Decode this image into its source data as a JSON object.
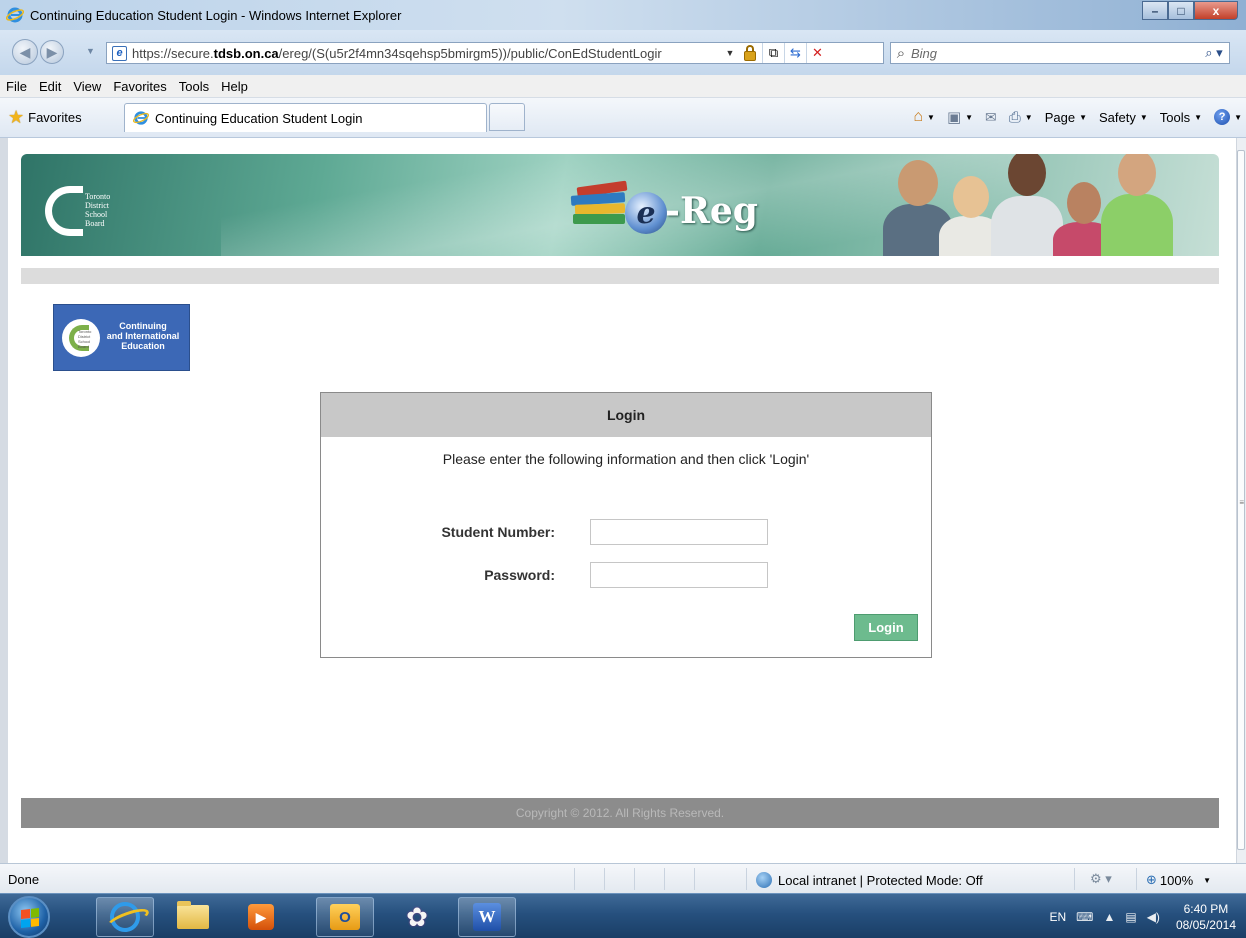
{
  "window": {
    "title": "Continuing Education Student Login - Windows Internet Explorer",
    "min_glyph": "–",
    "max_glyph": "□",
    "close_glyph": "x"
  },
  "addressbar": {
    "url_prefix": "https://secure.",
    "url_domain": "tdsb.on.ca",
    "url_path": "/ereg/(S(u5r2f4mn34sqehsp5bmirgm5))/public/ConEdStudentLogir",
    "search_placeholder": "Bing"
  },
  "menubar": {
    "items": [
      "File",
      "Edit",
      "View",
      "Favorites",
      "Tools",
      "Help"
    ]
  },
  "favbar": {
    "favorites_label": "Favorites",
    "tab_label": "Continuing Education Student Login",
    "cmd_page": "Page",
    "cmd_safety": "Safety",
    "cmd_tools": "Tools"
  },
  "banner": {
    "tdsb_lines": [
      "Toronto",
      "District",
      "School",
      "Board"
    ],
    "ereg_letter": "e",
    "ereg_word": "-Reg"
  },
  "cie_logo": {
    "lines": [
      "Continuing",
      "and International",
      "Education"
    ],
    "mini": [
      "Toronto",
      "District",
      "School",
      "Board"
    ]
  },
  "login": {
    "heading": "Login",
    "instruction": "Please enter the following information and then click 'Login'",
    "student_number_label": "Student Number:",
    "student_number_value": "",
    "password_label": "Password:",
    "password_value": "",
    "button_label": "Login"
  },
  "footer": {
    "copyright": "Copyright © 2012. All Rights Reserved."
  },
  "statusbar": {
    "status": "Done",
    "zone": "Local intranet | Protected Mode: Off",
    "zoom": "100%"
  },
  "taskbar": {
    "lang": "EN",
    "time": "6:40 PM",
    "date": "08/05/2014"
  },
  "colors": {
    "login_button": "#6dbb8e",
    "login_header": "#c8c8c8",
    "footer": "#8c8c8c",
    "cie_logo_bg": "#3c68b6"
  }
}
